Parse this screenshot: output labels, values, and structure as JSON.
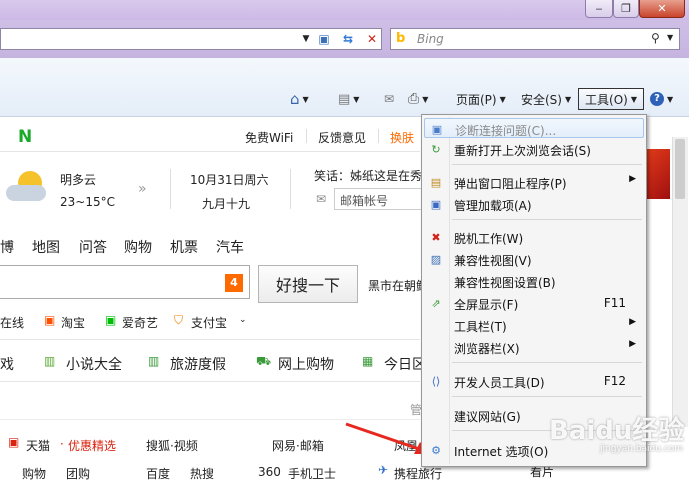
{
  "window": {
    "minimize": "‒",
    "restore": "❐",
    "close": "✕"
  },
  "address_bar": {
    "value": ""
  },
  "search": {
    "placeholder": "Bing",
    "engine_icon": "bing-icon"
  },
  "commandbar": {
    "page_label": "页面(P)",
    "safety_label": "安全(S)",
    "tools_label": "工具(O)"
  },
  "page": {
    "top_links": [
      "免费WiFi",
      "反馈意见",
      "换肤"
    ],
    "weather": {
      "desc": "明多云",
      "temp": "23~15°C"
    },
    "date": {
      "line1": "10月31日周六",
      "line2": "九月十九"
    },
    "joke": "笑话：姊纸这是在秀",
    "mail": "邮箱帐号",
    "nav": [
      "博",
      "地图",
      "问答",
      "购物",
      "机票",
      "汽车"
    ],
    "search_button": "好搜一下",
    "search_badge": "4",
    "search_hint": "黑市在朝鲜",
    "quick_links": [
      "在线",
      "淘宝",
      "爱奇艺",
      "支付宝"
    ],
    "categories": [
      "戏",
      "小说大全",
      "旅游度假",
      "网上购物",
      "今日区"
    ],
    "sites_row1": [
      "天猫",
      "优惠精选",
      "搜狐·视频",
      "网易·邮箱",
      "凤凰"
    ],
    "sites_row2": [
      "购物",
      "团购",
      "百度",
      "热搜",
      "360",
      "手机卫士",
      "携程旅行",
      "看片"
    ],
    "more_label": "管"
  },
  "tools_menu": {
    "items": [
      {
        "label": "诊断连接问题(C)...",
        "shortcut": "",
        "submenu": false,
        "disabled": true,
        "highlight": true,
        "icon": "diagnose-icon"
      },
      {
        "label": "重新打开上次浏览会话(S)",
        "shortcut": "",
        "submenu": false,
        "icon": "reopen-session-icon"
      },
      {
        "sep": true
      },
      {
        "label": "弹出窗口阻止程序(P)",
        "shortcut": "",
        "submenu": true,
        "icon": "popup-blocker-icon"
      },
      {
        "label": "管理加载项(A)",
        "shortcut": "",
        "submenu": false,
        "icon": "addons-icon"
      },
      {
        "sep": true
      },
      {
        "label": "脱机工作(W)",
        "shortcut": "",
        "submenu": false,
        "icon": "offline-icon"
      },
      {
        "label": "兼容性视图(V)",
        "shortcut": "",
        "submenu": false,
        "icon": "compat-view-icon"
      },
      {
        "label": "兼容性视图设置(B)",
        "shortcut": "",
        "submenu": false,
        "icon": ""
      },
      {
        "label": "全屏显示(F)",
        "shortcut": "F11",
        "submenu": false,
        "icon": "fullscreen-icon"
      },
      {
        "label": "工具栏(T)",
        "shortcut": "",
        "submenu": true,
        "icon": ""
      },
      {
        "label": "浏览器栏(X)",
        "shortcut": "",
        "submenu": true,
        "icon": ""
      },
      {
        "sep": true
      },
      {
        "label": "开发人员工具(D)",
        "shortcut": "F12",
        "submenu": false,
        "icon": "devtools-icon"
      },
      {
        "sep": true
      },
      {
        "label": "建议网站(G)",
        "shortcut": "",
        "submenu": false,
        "icon": ""
      },
      {
        "sep": true
      },
      {
        "label": "Internet 选项(O)",
        "shortcut": "",
        "submenu": false,
        "icon": "internet-options-icon"
      }
    ]
  },
  "watermark": {
    "text": "Baidu经验",
    "sub": "jingyan.baidu.com"
  },
  "colors": {
    "accent_orange": "#ff6a00",
    "link_red": "#d9230f",
    "menu_highlight": "#a9c7ea"
  }
}
